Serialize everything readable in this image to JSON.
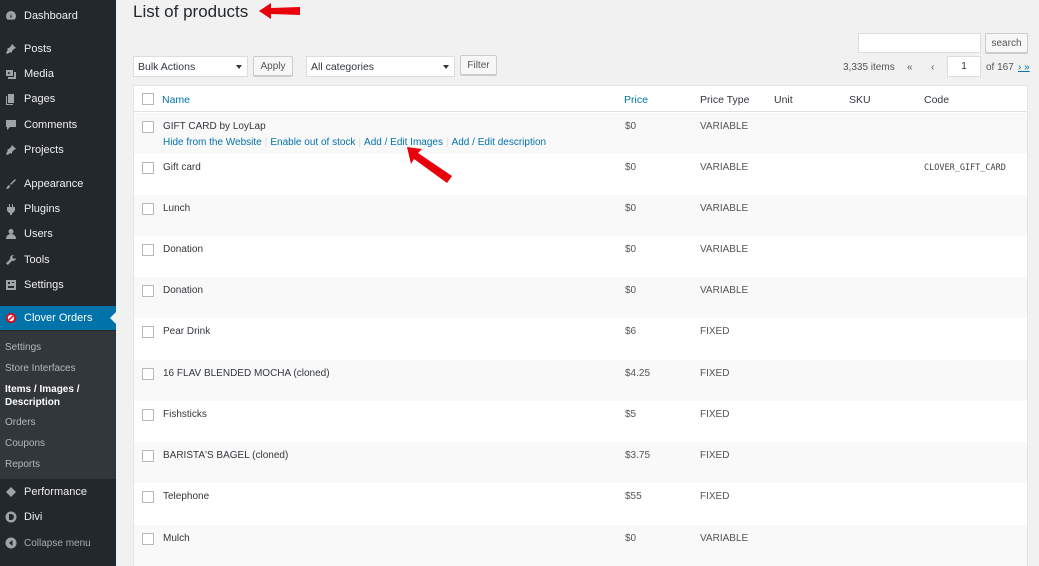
{
  "sidebar": {
    "items": [
      {
        "label": "Dashboard",
        "icon": "dashboard-icon"
      },
      {
        "label": "Posts",
        "icon": "pin-icon"
      },
      {
        "label": "Media",
        "icon": "media-icon"
      },
      {
        "label": "Pages",
        "icon": "pages-icon"
      },
      {
        "label": "Comments",
        "icon": "comments-icon"
      },
      {
        "label": "Projects",
        "icon": "pin-icon"
      },
      {
        "label": "Appearance",
        "icon": "brush-icon"
      },
      {
        "label": "Plugins",
        "icon": "plugin-icon"
      },
      {
        "label": "Users",
        "icon": "users-icon"
      },
      {
        "label": "Tools",
        "icon": "wrench-icon"
      },
      {
        "label": "Settings",
        "icon": "settings-icon"
      },
      {
        "label": "Clover Orders",
        "icon": "clover-icon"
      },
      {
        "label": "Performance",
        "icon": "performance-icon"
      },
      {
        "label": "Divi",
        "icon": "divi-icon"
      },
      {
        "label": "Collapse menu",
        "icon": "collapse-icon"
      }
    ],
    "submenu": [
      "Settings",
      "Store Interfaces",
      "Items / Images /",
      "Description",
      "Orders",
      "Coupons",
      "Reports"
    ]
  },
  "page": {
    "title": "List of products"
  },
  "toolbar": {
    "search_value": "",
    "search_label": "search",
    "bulk_actions": "Bulk Actions",
    "apply_label": "Apply",
    "categories": "All categories",
    "filter_label": "Filter",
    "items_count": "3,335 items",
    "first_page": "«",
    "prev_page": "‹",
    "current_page": "1",
    "of_pages": "of 167",
    "next_page": "›",
    "last_page": "»"
  },
  "table": {
    "columns": [
      "Name",
      "Price",
      "Price Type",
      "Unit",
      "SKU",
      "Code"
    ],
    "row_actions": [
      "Hide from the Website",
      "Enable out of stock",
      "Add / Edit Images",
      "Add / Edit description"
    ],
    "rows": [
      {
        "name": "GIFT CARD by LoyLap",
        "price": "$0",
        "type": "VARIABLE",
        "code": ""
      },
      {
        "name": "Gift card",
        "price": "$0",
        "type": "VARIABLE",
        "code": "CLOVER_GIFT_CARD"
      },
      {
        "name": "Lunch",
        "price": "$0",
        "type": "VARIABLE",
        "code": ""
      },
      {
        "name": "Donation",
        "price": "$0",
        "type": "VARIABLE",
        "code": ""
      },
      {
        "name": "Donation",
        "price": "$0",
        "type": "VARIABLE",
        "code": ""
      },
      {
        "name": "Pear Drink",
        "price": "$6",
        "type": "FIXED",
        "code": ""
      },
      {
        "name": "16 FLAV BLENDED MOCHA (cloned)",
        "price": "$4.25",
        "type": "FIXED",
        "code": ""
      },
      {
        "name": "Fishsticks",
        "price": "$5",
        "type": "FIXED",
        "code": ""
      },
      {
        "name": "BARISTA'S BAGEL (cloned)",
        "price": "$3.75",
        "type": "FIXED",
        "code": ""
      },
      {
        "name": "Telephone",
        "price": "$55",
        "type": "FIXED",
        "code": ""
      },
      {
        "name": "Mulch",
        "price": "$0",
        "type": "VARIABLE",
        "code": ""
      }
    ]
  },
  "colors": {
    "accent": "#0073aa",
    "sidebar": "#23282d",
    "annotation": "#e8000b"
  }
}
